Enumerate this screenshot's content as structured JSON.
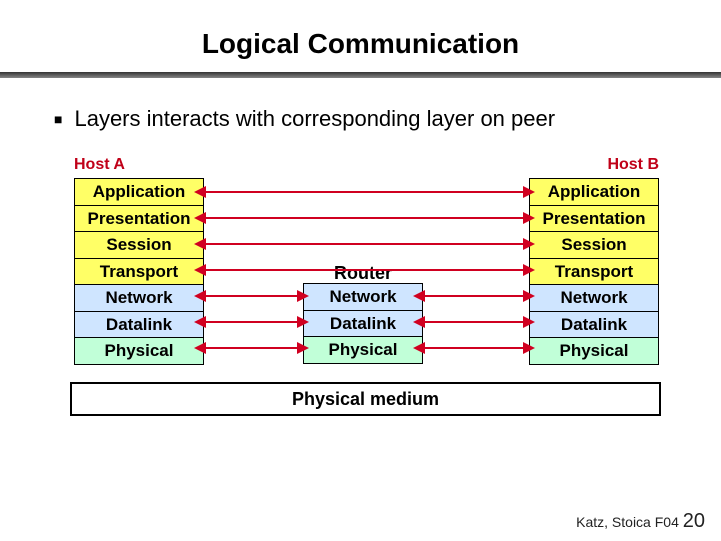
{
  "title": "Logical Communication",
  "bullet": "Layers interacts with corresponding layer on peer",
  "hostA_label": "Host A",
  "hostB_label": "Host B",
  "router_label": "Router",
  "layers": {
    "application": "Application",
    "presentation": "Presentation",
    "session": "Session",
    "transport": "Transport",
    "network": "Network",
    "datalink": "Datalink",
    "physical": "Physical"
  },
  "physical_medium": "Physical medium",
  "footer_text": "Katz, Stoica F04",
  "page_number": "20",
  "chart_data": {
    "type": "table",
    "title": "Logical Communication — OSI-style layer correspondence",
    "nodes": [
      "Host A",
      "Router",
      "Host B"
    ],
    "layers_top_to_bottom": [
      "Application",
      "Presentation",
      "Session",
      "Transport",
      "Network",
      "Datalink",
      "Physical"
    ],
    "stacks": {
      "Host A": [
        "Application",
        "Presentation",
        "Session",
        "Transport",
        "Network",
        "Datalink",
        "Physical"
      ],
      "Router": [
        "Network",
        "Datalink",
        "Physical"
      ],
      "Host B": [
        "Application",
        "Presentation",
        "Session",
        "Transport",
        "Network",
        "Datalink",
        "Physical"
      ]
    },
    "peer_links": [
      {
        "layer": "Application",
        "from": "Host A",
        "to": "Host B"
      },
      {
        "layer": "Presentation",
        "from": "Host A",
        "to": "Host B"
      },
      {
        "layer": "Session",
        "from": "Host A",
        "to": "Host B"
      },
      {
        "layer": "Transport",
        "from": "Host A",
        "to": "Host B"
      },
      {
        "layer": "Network",
        "from": "Host A",
        "to": "Router"
      },
      {
        "layer": "Network",
        "from": "Router",
        "to": "Host B"
      },
      {
        "layer": "Datalink",
        "from": "Host A",
        "to": "Router"
      },
      {
        "layer": "Datalink",
        "from": "Router",
        "to": "Host B"
      },
      {
        "layer": "Physical",
        "from": "Host A",
        "to": "Router"
      },
      {
        "layer": "Physical",
        "from": "Router",
        "to": "Host B"
      }
    ],
    "physical_medium_label": "Physical medium"
  }
}
